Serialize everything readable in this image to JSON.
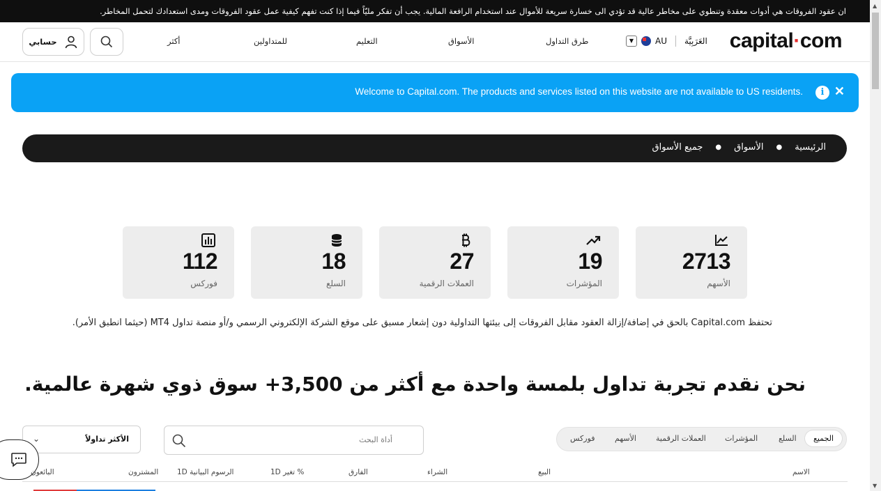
{
  "risk_warning": "ان عقود الفروقات هي أدوات معقدة وتنطوي على مخاطر عالية قد تؤدي الى خسارة سريعة للأموال عند استخدام الرافعة المالية. يجب أن تفكر مليّاً فيما إذا كنت تفهم كيفية عمل عقود الفروقات ومدى استعدادك لتحمل المخاطر.",
  "header": {
    "logo_main": "capital",
    "logo_dot": "·",
    "logo_end": "com",
    "region_code": "AU",
    "language": "العَرَبِيَّة",
    "nav": [
      "طرق التداول",
      "الأسواق",
      "التعليم",
      "للمتداولين",
      "أكثر"
    ],
    "account_label": "حسابي"
  },
  "notice": {
    "text": "Welcome to Capital.com. The products and services listed on this website are not available to US residents.",
    "info_glyph": "i",
    "close_glyph": "✕"
  },
  "breadcrumb": [
    "الرئيسية",
    "الأسواق",
    "جميع الأسواق"
  ],
  "cards": [
    {
      "value": "2713",
      "label": "الأسهم",
      "icon": "stock-chart-icon"
    },
    {
      "value": "19",
      "label": "المؤشرات",
      "icon": "trend-up-icon"
    },
    {
      "value": "27",
      "label": "العملات الرقمية",
      "icon": "bitcoin-icon"
    },
    {
      "value": "18",
      "label": "السلع",
      "icon": "coins-stack-icon"
    },
    {
      "value": "112",
      "label": "فوركس",
      "icon": "bar-chart-icon"
    }
  ],
  "disclaimer": "تحتفظ Capital.com بالحق في إضافة/إزالة العقود مقابل الفروقات إلى بيئتها التداولية دون إشعار مسبق على موقع الشركة الإلكتروني الرسمي و/أو منصة تداول MT4 (حيثما انطبق الأمر).",
  "headline": "نحن نقدم تجربة تداول بلمسة واحدة مع أكثر من 3,500+ سوق ذوي شهرة عالمية.",
  "filters": [
    "الجميع",
    "السلع",
    "المؤشرات",
    "العملات الرقمية",
    "الأسهم",
    "فوركس"
  ],
  "search": {
    "placeholder": "أداة البحث"
  },
  "sort": {
    "value": "الأكثر تداولاً"
  },
  "table_headers": [
    "الاسم",
    "البيع",
    "الشراء",
    "الفارق",
    "1D تغير %",
    "1D الرسوم البيانية",
    "المشترون",
    "البائعون"
  ],
  "colors": {
    "notice_bg": "#0aa2f5",
    "logo_dot": "#e62d2d",
    "breadcrumb_bg": "#1a1a1a",
    "card_bg": "#ededed"
  }
}
